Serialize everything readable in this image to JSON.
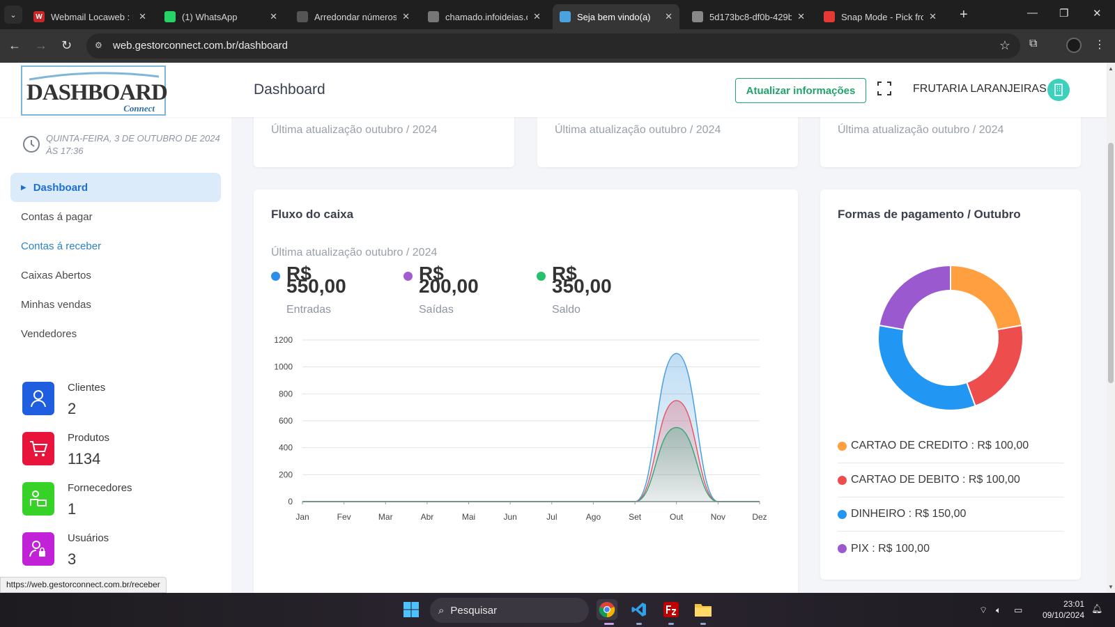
{
  "browser": {
    "tabs": [
      {
        "title": "Webmail Locaweb : F",
        "favicon_color": "#c62828",
        "favicon_letter": "W"
      },
      {
        "title": "(1) WhatsApp",
        "favicon_color": "#25d366",
        "favicon_letter": ""
      },
      {
        "title": "Arredondar números",
        "favicon_color": "#555555",
        "favicon_letter": ""
      },
      {
        "title": "chamado.infoideias.c",
        "favicon_color": "#777777",
        "favicon_letter": ""
      },
      {
        "title": "Seja bem vindo(a)",
        "favicon_color": "#4aa3df",
        "favicon_letter": ""
      },
      {
        "title": "5d173bc8-df0b-429b",
        "favicon_color": "#888888",
        "favicon_letter": ""
      },
      {
        "title": "Snap Mode - Pick fro",
        "favicon_color": "#e53935",
        "favicon_letter": ""
      }
    ],
    "active_tab_index": 4,
    "url": "web.gestorconnect.com.br/dashboard"
  },
  "header": {
    "logo_text": "DASHBOARD",
    "logo_sub": "Connect",
    "title": "Dashboard",
    "refresh_button": "Atualizar informações",
    "store_name": "FRUTARIA LARANJEIRAS"
  },
  "sidebar": {
    "datetime": "QUINTA-FEIRA, 3 DE OUTUBRO DE 2024 ÀS 17:36",
    "menu": [
      {
        "label": "Dashboard"
      },
      {
        "label": "Contas á pagar"
      },
      {
        "label": "Contas á receber"
      },
      {
        "label": "Caixas Abertos"
      },
      {
        "label": "Minhas vendas"
      },
      {
        "label": "Vendedores"
      }
    ],
    "stats": [
      {
        "label": "Clientes",
        "value": "2",
        "color": "#1f5fdf"
      },
      {
        "label": "Produtos",
        "value": "1134",
        "color": "#e8143c"
      },
      {
        "label": "Fornecedores",
        "value": "1",
        "color": "#37d227"
      },
      {
        "label": "Usuários",
        "value": "3",
        "color": "#c122d8"
      }
    ],
    "status_url": "https://web.gestorconnect.com.br/receber"
  },
  "top_cards": [
    {
      "updated": "Última atualização outubro / 2024"
    },
    {
      "updated": "Última atualização outubro / 2024"
    },
    {
      "updated": "Última atualização outubro / 2024"
    }
  ],
  "cashflow": {
    "title": "Fluxo do caixa",
    "updated": "Última atualização outubro / 2024",
    "summary": [
      {
        "currency": "R$",
        "amount": "550,00",
        "label": "Entradas",
        "color": "#2b8fe9"
      },
      {
        "currency": "R$",
        "amount": "200,00",
        "label": "Saídas",
        "color": "#a25dd1"
      },
      {
        "currency": "R$",
        "amount": "350,00",
        "label": "Saldo",
        "color": "#27c16b"
      }
    ]
  },
  "payments": {
    "title": "Formas de pagamento / Outubro",
    "items": [
      {
        "label": "CARTAO DE CREDITO : R$ 100,00",
        "color": "#ff9f40",
        "value": 100
      },
      {
        "label": "CARTAO DE DEBITO : R$ 100,00",
        "color": "#ee4d4d",
        "value": 100
      },
      {
        "label": "DINHEIRO : R$ 150,00",
        "color": "#2196f3",
        "value": 150
      },
      {
        "label": "PIX : R$ 100,00",
        "color": "#9b59d0",
        "value": 100
      }
    ]
  },
  "chart_data": [
    {
      "type": "area",
      "title": "Fluxo do caixa",
      "categories": [
        "Jan",
        "Fev",
        "Mar",
        "Abr",
        "Mai",
        "Jun",
        "Jul",
        "Ago",
        "Set",
        "Out",
        "Nov",
        "Dez"
      ],
      "ylim": [
        0,
        1200
      ],
      "yticks": [
        0,
        200,
        400,
        600,
        800,
        1000,
        1200
      ],
      "grid": true,
      "series": [
        {
          "color": "#4a9fe0",
          "values": [
            0,
            0,
            0,
            0,
            0,
            0,
            0,
            0,
            0,
            1100,
            0,
            0
          ]
        },
        {
          "color": "#e25b6a",
          "values": [
            0,
            0,
            0,
            0,
            0,
            0,
            0,
            0,
            0,
            750,
            0,
            0
          ]
        },
        {
          "color": "#3aa87a",
          "values": [
            0,
            0,
            0,
            0,
            0,
            0,
            0,
            0,
            0,
            550,
            0,
            0
          ]
        }
      ]
    },
    {
      "type": "pie",
      "title": "Formas de pagamento / Outubro",
      "categories": [
        "CARTAO DE CREDITO",
        "CARTAO DE DEBITO",
        "DINHEIRO",
        "PIX"
      ],
      "values": [
        100,
        100,
        150,
        100
      ],
      "colors": [
        "#ff9f40",
        "#ee4d4d",
        "#2196f3",
        "#9b59d0"
      ],
      "donut": true
    }
  ],
  "taskbar": {
    "search_placeholder": "Pesquisar",
    "time": "23:01",
    "date": "09/10/2024"
  }
}
